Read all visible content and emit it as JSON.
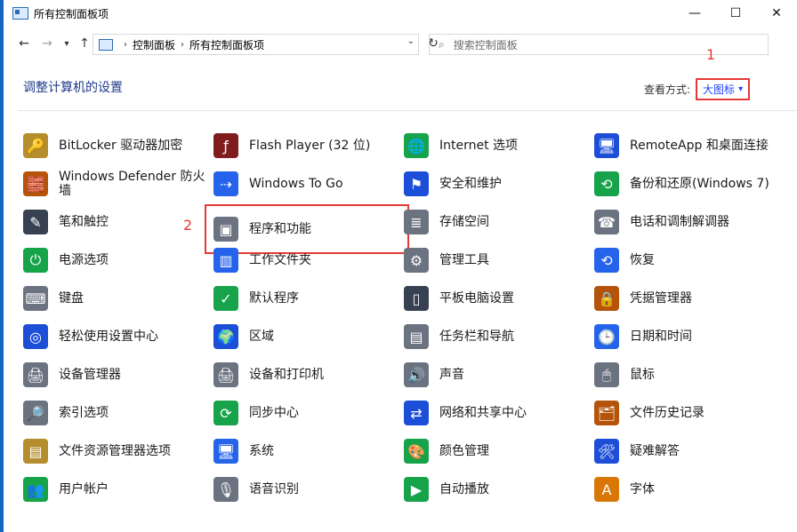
{
  "window": {
    "title": "所有控制面板项",
    "controls": {
      "minimize": "—",
      "maximize": "☐",
      "close": "✕"
    }
  },
  "address": {
    "breadcrumb": [
      "控制面板",
      "所有控制面板项"
    ],
    "search_placeholder": "搜索控制面板"
  },
  "header": {
    "title": "调整计算机的设置",
    "view_by_label": "查看方式:",
    "view_by_value": "大图标"
  },
  "annotations": [
    "1",
    "2"
  ],
  "colors": {
    "accent": "#1565c0",
    "highlight": "#e53935",
    "link": "#1e40ff"
  },
  "items": [
    {
      "label": "BitLocker 驱动器加密",
      "icon": "bitlocker-key-icon",
      "color": "#b58d2c"
    },
    {
      "label": "Flash Player (32 位)",
      "icon": "flash-icon",
      "color": "#7f1d1d"
    },
    {
      "label": "Internet 选项",
      "icon": "internet-options-icon",
      "color": "#16a34a"
    },
    {
      "label": "RemoteApp 和桌面连接",
      "icon": "remoteapp-icon",
      "color": "#1d4ed8"
    },
    {
      "label": "Windows Defender 防火墙",
      "icon": "firewall-icon",
      "color": "#b45309"
    },
    {
      "label": "Windows To Go",
      "icon": "windows-to-go-icon",
      "color": "#2563eb"
    },
    {
      "label": "安全和维护",
      "icon": "security-flag-icon",
      "color": "#1d4ed8"
    },
    {
      "label": "备份和还原(Windows 7)",
      "icon": "backup-restore-icon",
      "color": "#16a34a"
    },
    {
      "label": "笔和触控",
      "icon": "pen-icon",
      "color": "#374151"
    },
    {
      "label": "程序和功能",
      "icon": "programs-features-icon",
      "color": "#6b7280"
    },
    {
      "label": "存储空间",
      "icon": "storage-spaces-icon",
      "color": "#6b7280"
    },
    {
      "label": "电话和调制解调器",
      "icon": "phone-modem-icon",
      "color": "#6b7280"
    },
    {
      "label": "电源选项",
      "icon": "power-options-icon",
      "color": "#16a34a"
    },
    {
      "label": "工作文件夹",
      "icon": "work-folders-icon",
      "color": "#2563eb"
    },
    {
      "label": "管理工具",
      "icon": "admin-tools-icon",
      "color": "#6b7280"
    },
    {
      "label": "恢复",
      "icon": "recovery-icon",
      "color": "#2563eb"
    },
    {
      "label": "键盘",
      "icon": "keyboard-icon",
      "color": "#6b7280"
    },
    {
      "label": "默认程序",
      "icon": "default-programs-icon",
      "color": "#16a34a"
    },
    {
      "label": "平板电脑设置",
      "icon": "tablet-settings-icon",
      "color": "#374151"
    },
    {
      "label": "凭据管理器",
      "icon": "credential-manager-icon",
      "color": "#b45309"
    },
    {
      "label": "轻松使用设置中心",
      "icon": "ease-of-access-icon",
      "color": "#1d4ed8"
    },
    {
      "label": "区域",
      "icon": "region-icon",
      "color": "#1d4ed8"
    },
    {
      "label": "任务栏和导航",
      "icon": "taskbar-icon",
      "color": "#6b7280"
    },
    {
      "label": "日期和时间",
      "icon": "date-time-icon",
      "color": "#2563eb"
    },
    {
      "label": "设备管理器",
      "icon": "device-manager-icon",
      "color": "#6b7280"
    },
    {
      "label": "设备和打印机",
      "icon": "devices-printers-icon",
      "color": "#6b7280"
    },
    {
      "label": "声音",
      "icon": "sound-icon",
      "color": "#6b7280"
    },
    {
      "label": "鼠标",
      "icon": "mouse-icon",
      "color": "#6b7280"
    },
    {
      "label": "索引选项",
      "icon": "indexing-icon",
      "color": "#6b7280"
    },
    {
      "label": "同步中心",
      "icon": "sync-center-icon",
      "color": "#16a34a"
    },
    {
      "label": "网络和共享中心",
      "icon": "network-sharing-icon",
      "color": "#1d4ed8"
    },
    {
      "label": "文件历史记录",
      "icon": "file-history-icon",
      "color": "#b45309"
    },
    {
      "label": "文件资源管理器选项",
      "icon": "explorer-options-icon",
      "color": "#b58d2c"
    },
    {
      "label": "系统",
      "icon": "system-icon",
      "color": "#2563eb"
    },
    {
      "label": "颜色管理",
      "icon": "color-management-icon",
      "color": "#16a34a"
    },
    {
      "label": "疑难解答",
      "icon": "troubleshooting-icon",
      "color": "#1d4ed8"
    },
    {
      "label": "用户帐户",
      "icon": "user-accounts-icon",
      "color": "#16a34a"
    },
    {
      "label": "语音识别",
      "icon": "speech-recognition-icon",
      "color": "#6b7280"
    },
    {
      "label": "自动播放",
      "icon": "autoplay-icon",
      "color": "#16a34a"
    },
    {
      "label": "字体",
      "icon": "fonts-icon",
      "color": "#d97706"
    }
  ]
}
